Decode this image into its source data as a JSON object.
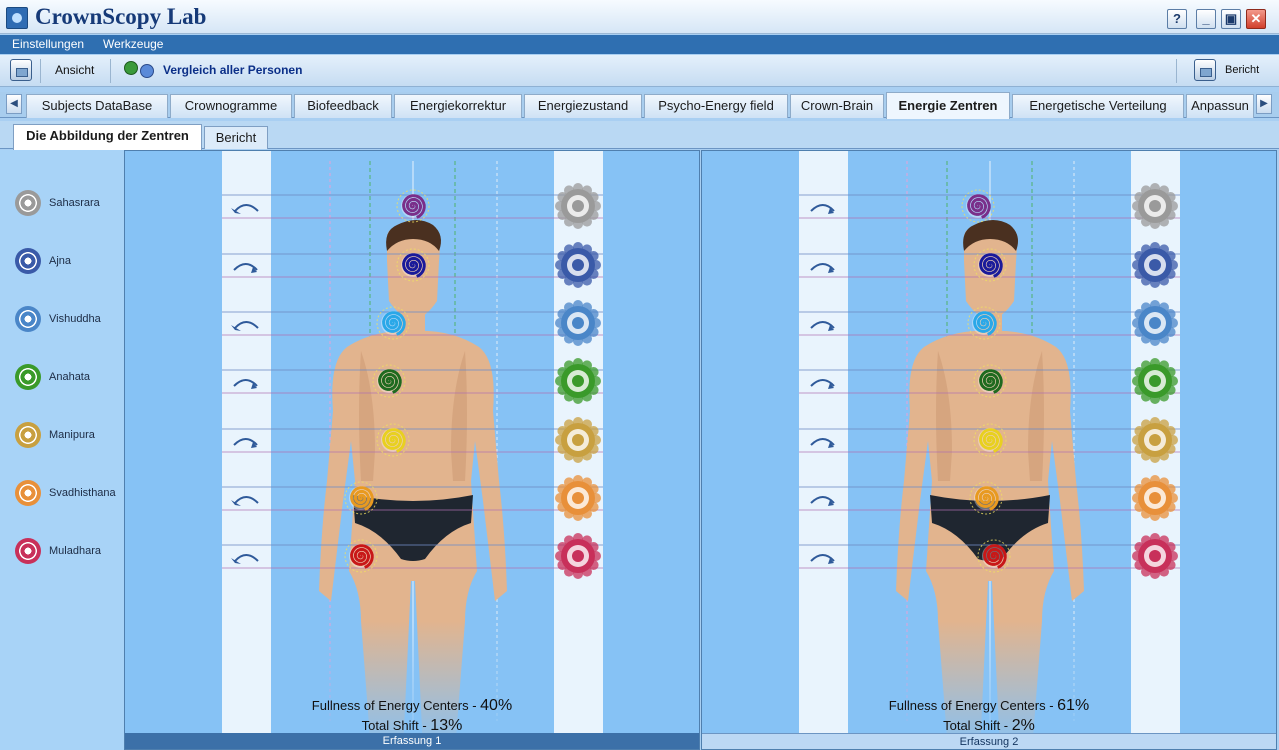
{
  "app": {
    "title": "CrownScopy Lab"
  },
  "window_buttons": {
    "help": "?",
    "minimize": "_",
    "maximize": "▣",
    "close": "✕"
  },
  "menu": [
    "Einstellungen",
    "Werkzeuge"
  ],
  "toolbar": {
    "view_label": "Ansicht",
    "compare_label": "Vergleich aller Personen",
    "report_label": "Bericht"
  },
  "tabs": [
    {
      "label": "Subjects DataBase",
      "active": false
    },
    {
      "label": "Crownogramme",
      "active": false
    },
    {
      "label": "Biofeedback",
      "active": false
    },
    {
      "label": "Energiekorrektur",
      "active": false
    },
    {
      "label": "Energiezustand",
      "active": false
    },
    {
      "label": "Psycho-Energy field",
      "active": false
    },
    {
      "label": "Crown-Brain",
      "active": false
    },
    {
      "label": "Energie Zentren",
      "active": true
    },
    {
      "label": "Energetische Verteilung",
      "active": false
    },
    {
      "label": "Anpassun",
      "active": false
    }
  ],
  "subtabs": [
    {
      "label": "Die Abbildung der Zentren",
      "active": true
    },
    {
      "label": "Bericht",
      "active": false
    }
  ],
  "chakras": [
    {
      "name": "Sahasrara",
      "color": "#9a9a9a"
    },
    {
      "name": "Ajna",
      "color": "#3a5aa8"
    },
    {
      "name": "Vishuddha",
      "color": "#4a86c8"
    },
    {
      "name": "Anahata",
      "color": "#3a9a2a"
    },
    {
      "name": "Manipura",
      "color": "#c8a040"
    },
    {
      "name": "Svadhisthana",
      "color": "#e8903a"
    },
    {
      "name": "Muladhara",
      "color": "#c8305a"
    }
  ],
  "panels": [
    {
      "footer": "Erfassung 1",
      "fullness_label": "Fullness of Energy Centers - ",
      "fullness_value": "40%",
      "shift_label": "Total Shift - ",
      "shift_value": "13%",
      "rotations": [
        "ccw",
        "cw",
        "ccw",
        "cw",
        "cw",
        "ccw",
        "ccw"
      ],
      "spiral_colors": [
        "#7a2f8a",
        "#1a1a9a",
        "#2aa8e8",
        "#1f6a1f",
        "#e8d020",
        "#e89a20",
        "#c81818"
      ],
      "spiral_offsets": [
        0,
        0,
        -20,
        -24,
        -20,
        -52,
        -52
      ]
    },
    {
      "footer": "Erfassung 2",
      "fullness_label": "Fullness of Energy Centers - ",
      "fullness_value": "61%",
      "shift_label": "Total Shift - ",
      "shift_value": "2%",
      "rotations": [
        "cw",
        "cw",
        "cw",
        "cw",
        "cw",
        "cw",
        "cw"
      ],
      "spiral_colors": [
        "#7a2f8a",
        "#1a1a9a",
        "#2aa8e8",
        "#1f6a1f",
        "#e8d020",
        "#e89a20",
        "#c81818"
      ],
      "spiral_offsets": [
        -12,
        0,
        -6,
        0,
        0,
        -4,
        4
      ]
    }
  ]
}
